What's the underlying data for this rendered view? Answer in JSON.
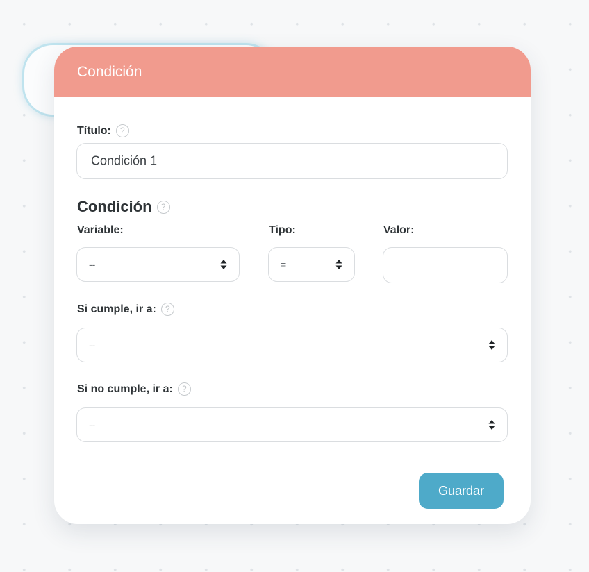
{
  "modal": {
    "title": "Condición",
    "titulo_label": "Título:",
    "titulo_value": "Condición 1",
    "condition_heading": "Condición",
    "variable_label": "Variable:",
    "variable_value": "--",
    "tipo_label": "Tipo:",
    "tipo_value": "=",
    "valor_label": "Valor:",
    "valor_value": "",
    "si_cumple_label": "Si cumple, ir a:",
    "si_cumple_value": "--",
    "si_no_cumple_label": "Si no cumple, ir a:",
    "si_no_cumple_value": "--",
    "save_label": "Guardar",
    "help_glyph": "?"
  },
  "colors": {
    "header": "#f19b8e",
    "save_button": "#4eaac9",
    "ghost_node_border": "#bfe3ee"
  }
}
